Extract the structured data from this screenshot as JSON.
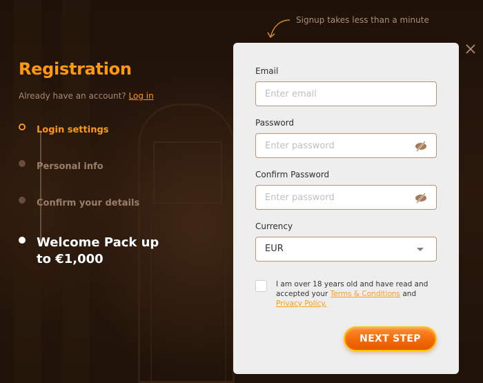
{
  "left_panel": {
    "title": "Registration",
    "subtitle_text": "Already have an account?",
    "login_link": "Log in",
    "steps": [
      {
        "label": "Login settings",
        "state": "active"
      },
      {
        "label": "Personal info",
        "state": "inactive"
      },
      {
        "label": "Confirm your details",
        "state": "inactive"
      },
      {
        "label_line1": "Welcome Pack up",
        "label_line2": "to €1,000",
        "state": "final"
      }
    ]
  },
  "hint": "Signup takes less than a minute",
  "form": {
    "email": {
      "label": "Email",
      "placeholder": "Enter email",
      "value": ""
    },
    "password": {
      "label": "Password",
      "placeholder": "Enter password",
      "value": ""
    },
    "confirm_password": {
      "label": "Confirm Password",
      "placeholder": "Enter password",
      "value": ""
    },
    "currency": {
      "label": "Currency",
      "selected": "EUR"
    },
    "terms": {
      "checked": false,
      "text_before": "I am over 18 years old and have read and accepted your",
      "terms_link": "Terms & Conditions",
      "text_middle": "and",
      "privacy_link": "Privacy Policy."
    },
    "next_button": "NEXT STEP"
  },
  "colors": {
    "accent": "#ff9a0e",
    "background": "#231409",
    "modal_bg": "#eeeeee",
    "input_border": "#b8927a",
    "button_orange": "#f26a08",
    "button_border": "#ffc400"
  }
}
